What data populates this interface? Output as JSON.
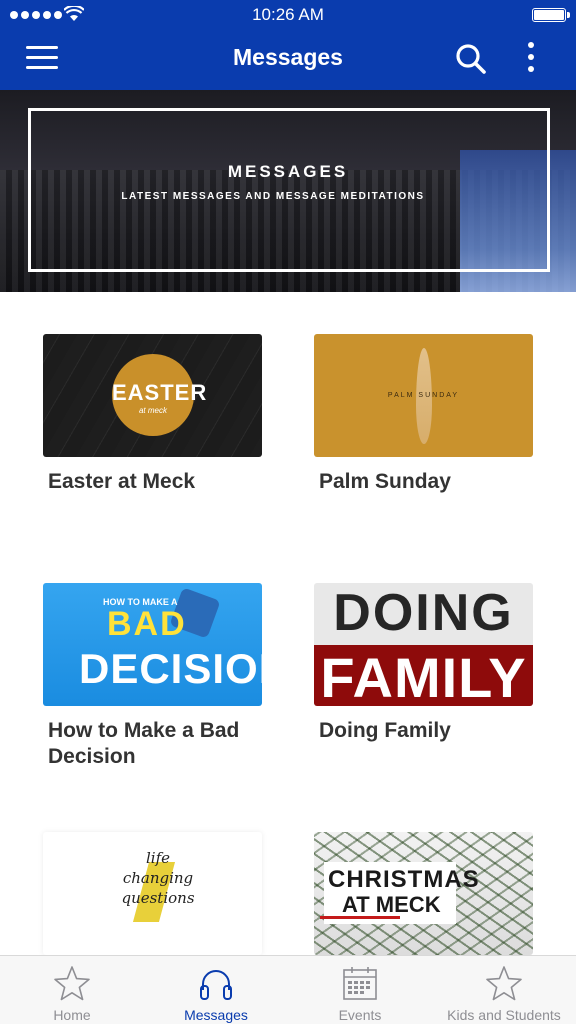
{
  "status_bar": {
    "time": "10:26 AM"
  },
  "header": {
    "title": "Messages"
  },
  "hero": {
    "title": "MESSAGES",
    "subtitle": "LATEST MESSAGES AND MESSAGE MEDITATIONS"
  },
  "messages": [
    {
      "title": "Easter at Meck",
      "art_big": "EASTER",
      "art_small": "at meck"
    },
    {
      "title": "Palm Sunday",
      "art_text": "PALM SUNDAY"
    },
    {
      "title": "How to Make a Bad Decision",
      "art_line1": "HOW TO MAKE A",
      "art_line2": "BAD",
      "art_line3": "DECISION"
    },
    {
      "title": "Doing Family",
      "art_line1": "DOING",
      "art_line2": "FAMILY"
    },
    {
      "art_text_1": "life",
      "art_text_2": "changing",
      "art_text_3": "questions"
    },
    {
      "art_line1": "CHRISTMAS",
      "art_line2": "AT MECK"
    }
  ],
  "tabs": [
    {
      "label": "Home",
      "icon": "star-icon",
      "active": false
    },
    {
      "label": "Messages",
      "icon": "headphones-icon",
      "active": true
    },
    {
      "label": "Events",
      "icon": "calendar-icon",
      "active": false
    },
    {
      "label": "Kids and Students",
      "icon": "star-icon",
      "active": false
    }
  ],
  "colors": {
    "brand": "#0a3cae",
    "inactive_tab": "#8e8e93",
    "title_text": "#333333"
  }
}
